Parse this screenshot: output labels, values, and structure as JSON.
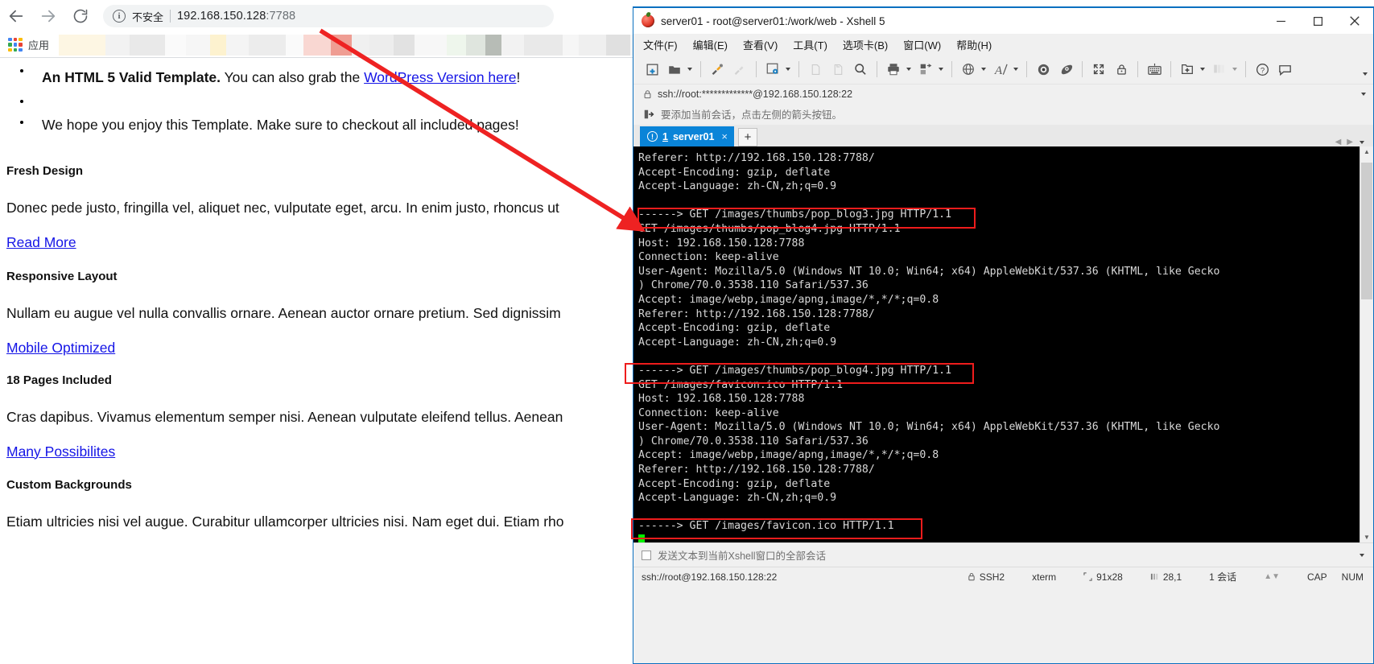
{
  "browser": {
    "nav": {
      "back": "back-arrow",
      "forward": "forward-arrow",
      "reload": "reload"
    },
    "omnibox": {
      "info_icon": "i",
      "security_label": "不安全",
      "url_host": "192.168.150.128",
      "url_port": ":7788"
    },
    "bookmarks": {
      "apps_label": "应用"
    },
    "page": {
      "bullet1_bold": "An HTML 5 Valid Template.",
      "bullet1_rest": " You can also grab the ",
      "bullet1_link": "WordPress Version here",
      "bullet1_tail": "!",
      "bullet2": "We hope you enjoy this Template. Make sure to checkout all included pages!",
      "sections": [
        {
          "heading": "Fresh Design",
          "body": "Donec pede justo, fringilla vel, aliquet nec, vulputate eget, arcu. In enim justo, rhoncus ut",
          "link": "Read More"
        },
        {
          "heading": "Responsive Layout",
          "body": "Nullam eu augue vel nulla convallis ornare. Aenean auctor ornare pretium. Sed dignissim",
          "link": "Mobile Optimized"
        },
        {
          "heading": "18 Pages Included",
          "body": "Cras dapibus. Vivamus elementum semper nisi. Aenean vulputate eleifend tellus. Aenean",
          "link": "Many Possibilites"
        },
        {
          "heading": "Custom Backgrounds",
          "body": "Etiam ultricies nisi vel augue. Curabitur ullamcorper ultricies nisi. Nam eget dui. Etiam rho",
          "link": ""
        }
      ]
    }
  },
  "xshell": {
    "title": "server01 - root@server01:/work/web - Xshell 5",
    "window_buttons": {
      "minimize": "minimize-icon",
      "maximize": "maximize-icon",
      "close": "close-icon"
    },
    "menu": [
      "文件(F)",
      "编辑(E)",
      "查看(V)",
      "工具(T)",
      "选项卡(B)",
      "窗口(W)",
      "帮助(H)"
    ],
    "toolbar_icons": [
      "new-session-icon",
      "open-folder-icon",
      "connect-icon",
      "disconnect-icon",
      "session-properties-icon",
      "copy-icon",
      "paste-icon",
      "find-icon",
      "print-icon",
      "transfer-icon",
      "globe-icon",
      "font-icon",
      "ssh-tunnel-icon",
      "ftp-icon",
      "fullscreen-icon",
      "lock-icon",
      "keyboard-icon",
      "add-session-icon",
      "layout-icon",
      "help-icon",
      "chat-icon"
    ],
    "address": {
      "lock_icon": "lock-icon",
      "value": "ssh://root:*************@192.168.150.128:22"
    },
    "hint": {
      "icon": "add-session-arrow-icon",
      "text": "要添加当前会话，点击左侧的箭头按钮。"
    },
    "tab": {
      "warn_icon": "!",
      "index": "1",
      "name": "server01",
      "close": "×",
      "new_tab": "+"
    },
    "terminal": {
      "lines": [
        "Referer: http://192.168.150.128:7788/",
        "Accept-Encoding: gzip, deflate",
        "Accept-Language: zh-CN,zh;q=0.9",
        "",
        "------> GET /images/thumbs/pop_blog3.jpg HTTP/1.1",
        "GET /images/thumbs/pop_blog4.jpg HTTP/1.1",
        "Host: 192.168.150.128:7788",
        "Connection: keep-alive",
        "User-Agent: Mozilla/5.0 (Windows NT 10.0; Win64; x64) AppleWebKit/537.36 (KHTML, like Gecko",
        ") Chrome/70.0.3538.110 Safari/537.36",
        "Accept: image/webp,image/apng,image/*,*/*;q=0.8",
        "Referer: http://192.168.150.128:7788/",
        "Accept-Encoding: gzip, deflate",
        "Accept-Language: zh-CN,zh;q=0.9",
        "",
        "------> GET /images/thumbs/pop_blog4.jpg HTTP/1.1",
        "GET /images/favicon.ico HTTP/1.1",
        "Host: 192.168.150.128:7788",
        "Connection: keep-alive",
        "User-Agent: Mozilla/5.0 (Windows NT 10.0; Win64; x64) AppleWebKit/537.36 (KHTML, like Gecko",
        ") Chrome/70.0.3538.110 Safari/537.36",
        "Accept: image/webp,image/apng,image/*,*/*;q=0.8",
        "Referer: http://192.168.150.128:7788/",
        "Accept-Encoding: gzip, deflate",
        "Accept-Language: zh-CN,zh;q=0.9",
        "",
        "------> GET /images/favicon.ico HTTP/1.1"
      ],
      "highlights": [
        "------> GET /images/thumbs/pop_blog3.jpg HTTP/1.1",
        "------> GET /images/thumbs/pop_blog4.jpg HTTP/1.1",
        "------> GET /images/favicon.ico HTTP/1.1"
      ],
      "highlight_color": "#ee1c1c",
      "cursor_color": "#00ee00"
    },
    "send_bar": {
      "label": "发送文本到当前Xshell窗口的全部会话"
    },
    "status": {
      "connection": "ssh://root@192.168.150.128:22",
      "protocol": "SSH2",
      "term_type": "xterm",
      "size": "91x28",
      "cursor_pos": "28,1",
      "sessions": "1 会话",
      "cap": "CAP",
      "num": "NUM"
    }
  }
}
